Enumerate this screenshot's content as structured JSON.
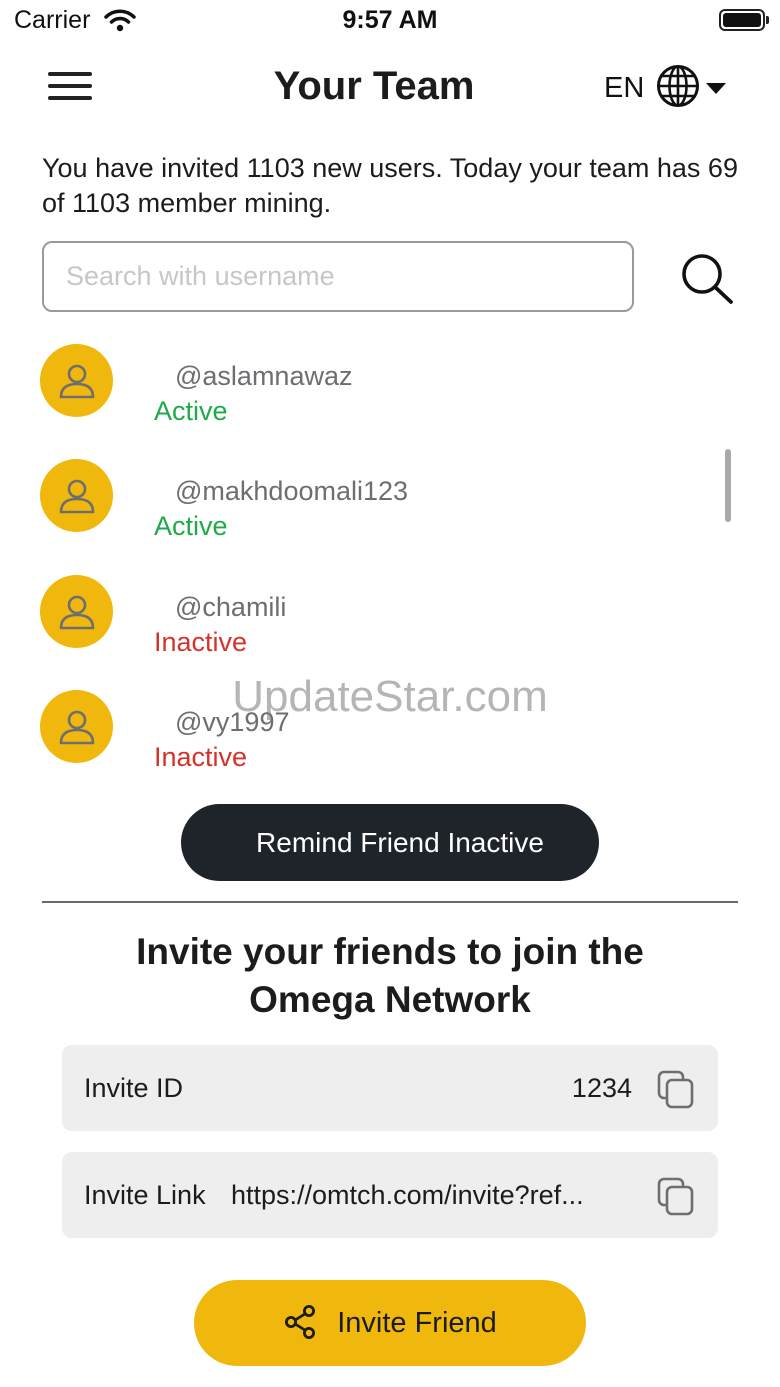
{
  "status_bar": {
    "carrier": "Carrier",
    "time": "9:57 AM"
  },
  "header": {
    "title": "Your Team",
    "language": "EN"
  },
  "summary": "You have invited 1103 new users. Today your team has 69 of 1103 member mining.",
  "search": {
    "placeholder": "Search with username",
    "value": ""
  },
  "members": [
    {
      "username": "@aslamnawaz",
      "status": "Active"
    },
    {
      "username": "@makhdoomali123",
      "status": "Active"
    },
    {
      "username": "@chamili",
      "status": "Inactive"
    },
    {
      "username": "@vy1997",
      "status": "Inactive"
    }
  ],
  "watermark": "UpdateStar.com",
  "remind_button": "Remind Friend Inactive",
  "invite": {
    "heading_line1": "Invite your friends to join the",
    "heading_line2": "Omega Network",
    "id_label": "Invite ID",
    "id_value": "1234",
    "link_label": "Invite Link",
    "link_value": "https://omtch.com/invite?ref...",
    "button_label": "Invite Friend"
  },
  "colors": {
    "accent": "#f0b80c",
    "active": "#1faa4a",
    "inactive": "#d5322a",
    "dark_button": "#1f232a"
  },
  "icons": [
    "wifi-icon",
    "battery-icon",
    "menu-icon",
    "globe-icon",
    "search-icon",
    "user-icon",
    "copy-icon",
    "share-icon"
  ]
}
